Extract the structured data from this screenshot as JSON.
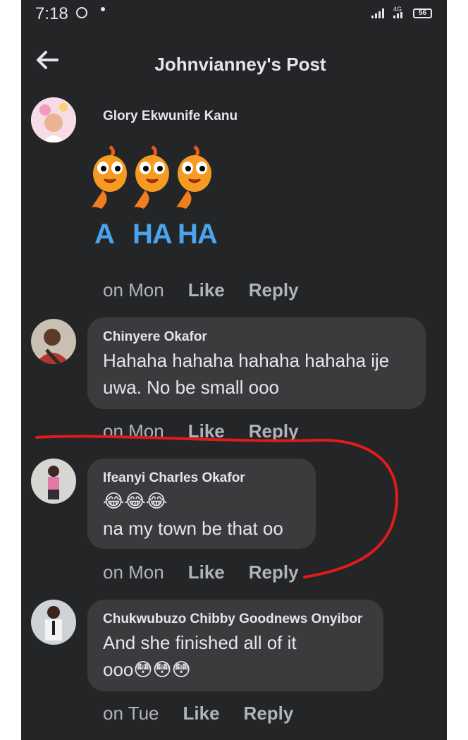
{
  "status_bar": {
    "time": "7:18",
    "network": "4G",
    "battery": "56"
  },
  "header": {
    "title": "Johnvianney's Post",
    "back_icon": "arrow-left-icon"
  },
  "comments": [
    {
      "author": "Glory Ekwunife Kanu",
      "sticker_caption": [
        "A",
        "HA",
        "HA"
      ],
      "time": "on Mon",
      "like": "Like",
      "reply": "Reply"
    },
    {
      "author": "Chinyere Okafor",
      "text_line1": "Hahaha hahaha hahaha hahaha ije",
      "text_line2": "uwa. No be small ooo",
      "time": "on Mon",
      "like": "Like",
      "reply": "Reply"
    },
    {
      "author": "Ifeanyi Charles Okafor",
      "emoji_line": "😂😂😂",
      "text": "na my town be that oo",
      "time": "on Mon",
      "like": "Like",
      "reply": "Reply"
    },
    {
      "author": "Chukwubuzo Chibby Goodnews Onyibor",
      "text_line1": "And she finished all of it",
      "text_line2_prefix": "ooo",
      "text_line2_emoji": "😳😳😳",
      "time": "on Tue",
      "like": "Like",
      "reply": "Reply"
    }
  ],
  "colors": {
    "background": "#242526",
    "bubble": "#3a3b3c",
    "text": "#e4e6eb",
    "meta": "#b0b3b8",
    "sticker_caption": "#4aa3ee",
    "annotation": "#e01b1b"
  }
}
